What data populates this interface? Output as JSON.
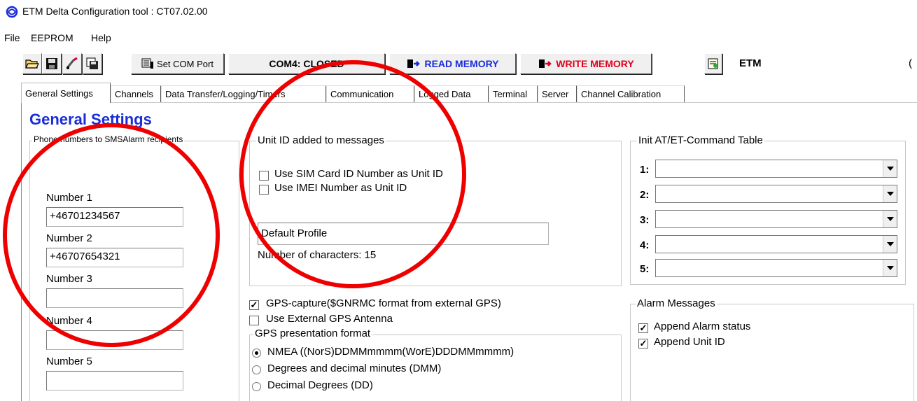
{
  "window": {
    "title": "ETM Delta Configuration tool : CT07.02.00"
  },
  "menu": [
    "File",
    "EEPROM",
    "Help"
  ],
  "toolbar": {
    "set_com_port": "Set COM Port",
    "com_status": "COM4: CLOSED",
    "read_memory": "READ MEMORY",
    "write_memory": "WRITE MEMORY",
    "brand": "ETM",
    "trailing_char": "("
  },
  "tabs": [
    "General Settings",
    "Channels",
    "Data Transfer/Logging/Timers",
    "Communication",
    "Logged Data",
    "Terminal",
    "Server",
    "Channel Calibration"
  ],
  "page_title": "General Settings",
  "phone_group": {
    "legend": "Phone numbers to SMSAlarm recipients",
    "numbers": [
      {
        "label": "Number 1",
        "value": "+46701234567"
      },
      {
        "label": "Number 2",
        "value": "+46707654321"
      },
      {
        "label": "Number 3",
        "value": ""
      },
      {
        "label": "Number 4",
        "value": ""
      },
      {
        "label": "Number 5",
        "value": ""
      }
    ]
  },
  "unit_id_group": {
    "legend": "Unit ID added to messages",
    "use_sim_label": "Use SIM Card ID Number as Unit ID",
    "use_sim_checked": false,
    "use_imei_label": "Use IMEI Number as Unit ID",
    "use_imei_checked": false,
    "profile_value": "Default Profile",
    "char_count_text": "Number of characters: 15"
  },
  "gps": {
    "capture_label": "GPS-capture($GNRMC format from external GPS)",
    "capture_checked": true,
    "external_antenna_label": "Use External GPS Antenna",
    "external_antenna_checked": false,
    "format_legend": "GPS presentation format",
    "formats": [
      {
        "label": "NMEA ((NorS)DDMMmmmm(WorE)DDDMMmmmm)",
        "selected": true
      },
      {
        "label": "Degrees and decimal minutes (DMM)",
        "selected": false
      },
      {
        "label": "Decimal Degrees (DD)",
        "selected": false
      }
    ]
  },
  "init_table": {
    "legend": "Init AT/ET-Command Table",
    "rows": [
      "1:",
      "2:",
      "3:",
      "4:",
      "5:"
    ]
  },
  "alarm_messages": {
    "legend": "Alarm Messages",
    "append_status_label": "Append Alarm status",
    "append_status_checked": true,
    "append_unit_label": "Append Unit ID",
    "append_unit_checked": true
  },
  "colors": {
    "accent_blue": "#1a2cd8",
    "accent_red": "#e0001a",
    "annotation_red": "#ee0000"
  }
}
